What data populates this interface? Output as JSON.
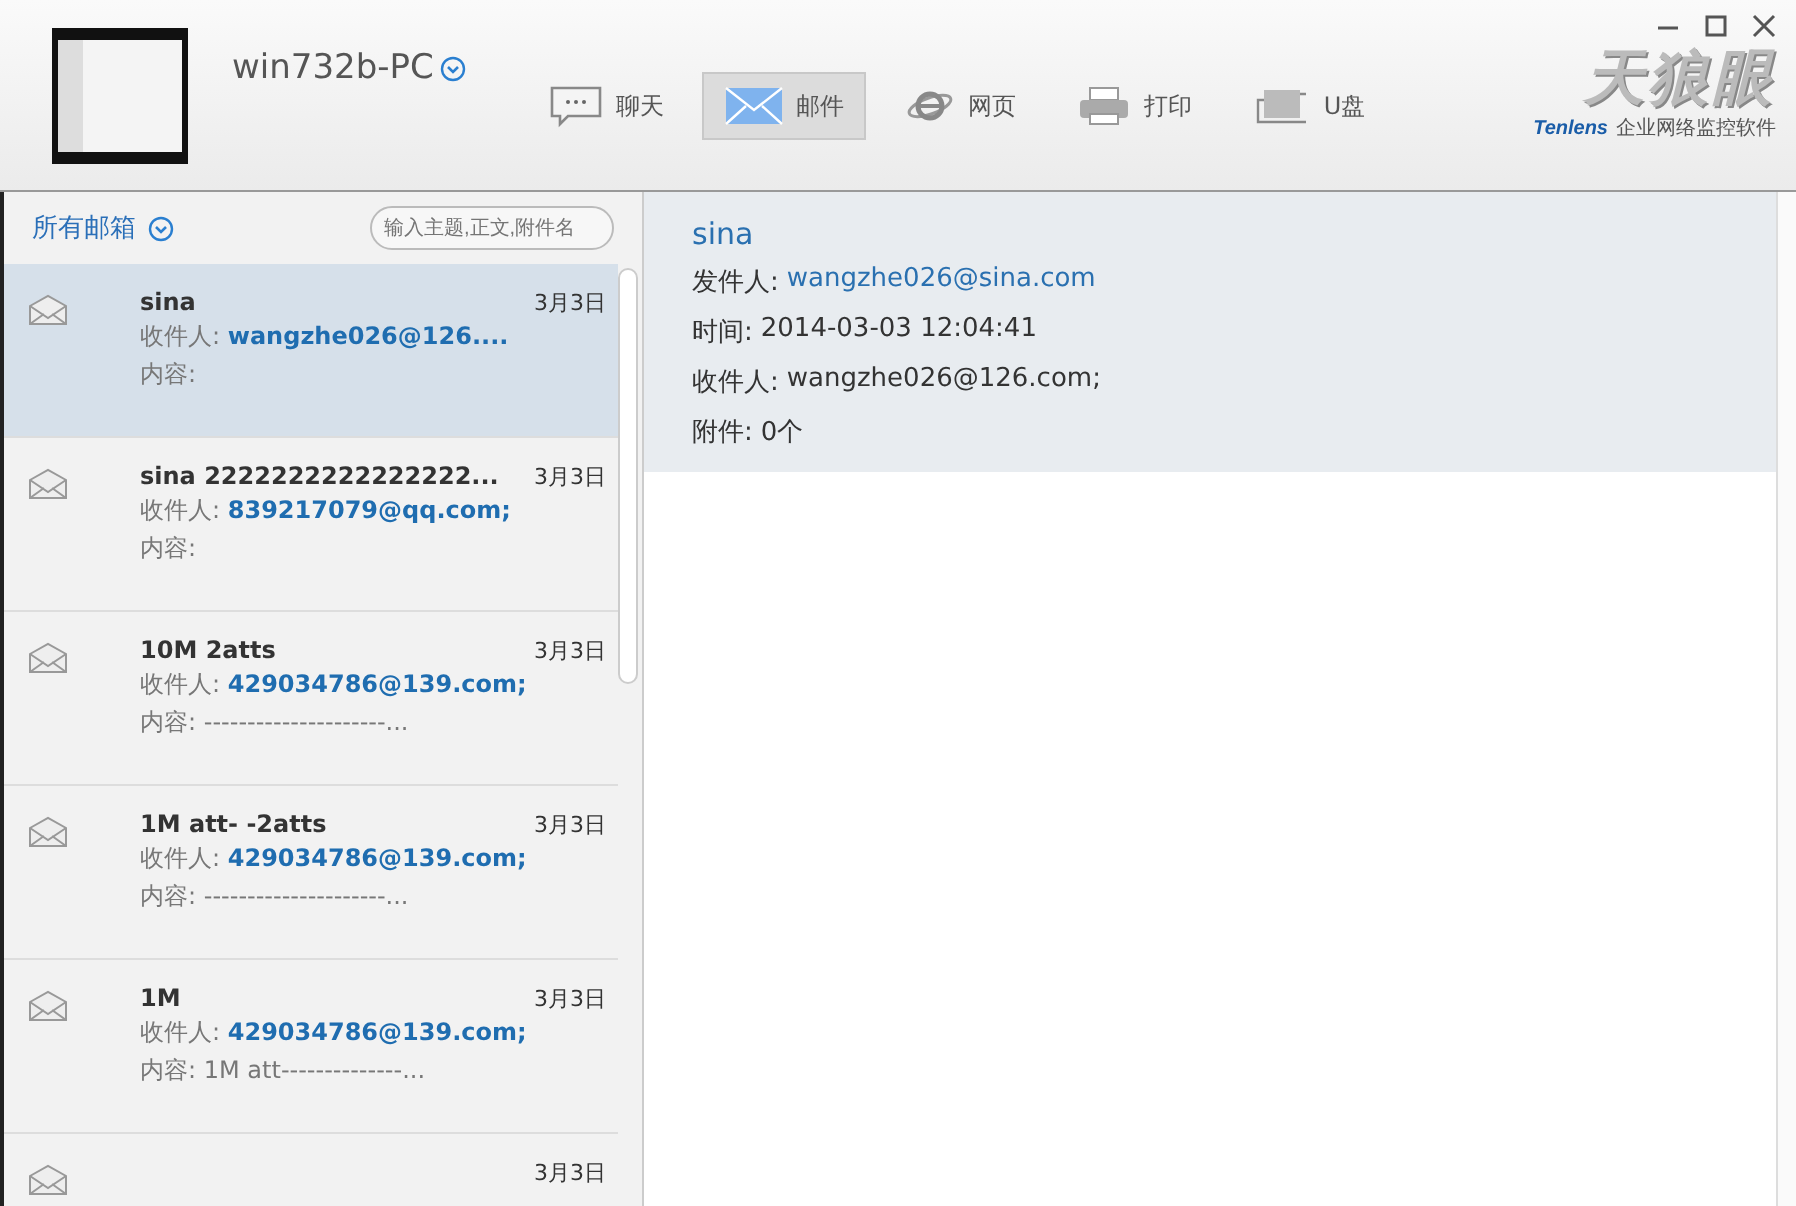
{
  "header": {
    "computer_name": "win732b-PC",
    "logo_text": "天狼眼",
    "brand": "Tenlens",
    "tagline": "企业网络监控软件"
  },
  "nav_tabs": [
    {
      "kind": "chat",
      "label": "聊天",
      "selected": false
    },
    {
      "kind": "mail",
      "label": "邮件",
      "selected": true
    },
    {
      "kind": "web",
      "label": "网页",
      "selected": false
    },
    {
      "kind": "print",
      "label": "打印",
      "selected": false
    },
    {
      "kind": "usb",
      "label": "U盘",
      "selected": false
    }
  ],
  "sidebar": {
    "mailbox_filter": "所有邮箱",
    "search": {
      "placeholder": "输入主题,正文,附件名"
    }
  },
  "mail_list": [
    {
      "subject": "sina",
      "recipient_label": "收件人:",
      "recipient": "wangzhe026@126....",
      "content_label": "内容:",
      "date": "3月3日",
      "selected": true
    },
    {
      "subject": "sina  2222222222222222...",
      "recipient_label": "收件人:",
      "recipient": "839217079@qq.com;",
      "content_label": "内容:",
      "date": "3月3日",
      "selected": false
    },
    {
      "subject": "10M 2atts",
      "recipient_label": "收件人:",
      "recipient": "429034786@139.com;",
      "content_label": "内容:",
      "content": "---------------------...",
      "date": "3月3日",
      "selected": false
    },
    {
      "subject": "1M att- -2atts",
      "recipient_label": "收件人:",
      "recipient": "429034786@139.com;",
      "content_label": "内容:",
      "content": "---------------------...",
      "date": "3月3日",
      "selected": false
    },
    {
      "subject": "1M",
      "recipient_label": "收件人:",
      "recipient": "429034786@139.com;",
      "content_label": "内容:",
      "content": "1M att--------------...",
      "date": "3月3日",
      "selected": false
    },
    {
      "date": "3月3日",
      "selected": false
    }
  ],
  "detail": {
    "subject": "sina",
    "fields": [
      {
        "label": "发件人:",
        "value": "wangzhe026@sina.com",
        "kind": "link"
      },
      {
        "label": "时间:",
        "value": "2014-03-03 12:04:41",
        "kind": "text"
      },
      {
        "label": "收件人:",
        "value": "wangzhe026@126.com;",
        "kind": "text"
      },
      {
        "label": "附件:",
        "value": "0个",
        "kind": "text"
      }
    ]
  }
}
